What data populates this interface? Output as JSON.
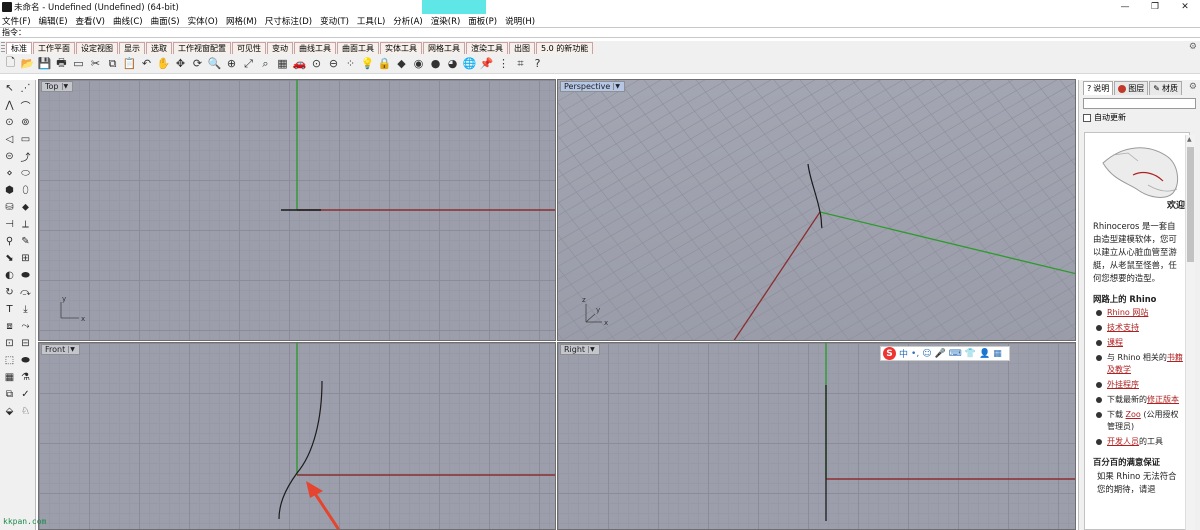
{
  "window": {
    "title": "未命名 - Undefined (Undefined) (64-bit)",
    "controls": {
      "minimize": "—",
      "maximize": "❐",
      "close": "✕"
    }
  },
  "menu": [
    "文件(F)",
    "编辑(E)",
    "查看(V)",
    "曲线(C)",
    "曲面(S)",
    "实体(O)",
    "网格(M)",
    "尺寸标注(D)",
    "变动(T)",
    "工具(L)",
    "分析(A)",
    "渲染(R)",
    "面板(P)",
    "说明(H)"
  ],
  "command": {
    "label": "指令：",
    "value": ""
  },
  "tabs": [
    "标准",
    "工作平面",
    "设定视图",
    "显示",
    "选取",
    "工作视窗配置",
    "可见性",
    "变动",
    "曲线工具",
    "曲面工具",
    "实体工具",
    "网格工具",
    "渲染工具",
    "出图",
    "5.0 的新功能"
  ],
  "active_tab": 0,
  "toolbar_icons": [
    {
      "icon": "new-file-icon",
      "glyph": "🗋"
    },
    {
      "icon": "open-folder-icon",
      "glyph": "📂"
    },
    {
      "icon": "save-icon",
      "glyph": "💾"
    },
    {
      "icon": "print-icon",
      "glyph": "🖶"
    },
    {
      "icon": "document-icon",
      "glyph": "▭"
    },
    {
      "icon": "cut-icon",
      "glyph": "✂"
    },
    {
      "icon": "copy-icon",
      "glyph": "⧉"
    },
    {
      "icon": "paste-icon",
      "glyph": "📋"
    },
    {
      "icon": "undo-icon",
      "glyph": "↶"
    },
    {
      "icon": "pan-hand-icon",
      "glyph": "✋"
    },
    {
      "icon": "move-icon",
      "glyph": "✥"
    },
    {
      "icon": "rotate-view-icon",
      "glyph": "⟳"
    },
    {
      "icon": "zoom-icon",
      "glyph": "🔍"
    },
    {
      "icon": "zoom-window-icon",
      "glyph": "⊕"
    },
    {
      "icon": "zoom-extents-icon",
      "glyph": "⤢"
    },
    {
      "icon": "zoom-selected-icon",
      "glyph": "⌕"
    },
    {
      "icon": "viewport-layout-icon",
      "glyph": "▦"
    },
    {
      "icon": "car-icon",
      "glyph": "🚗"
    },
    {
      "icon": "view-setup-icon",
      "glyph": "⊙"
    },
    {
      "icon": "cplane-icon",
      "glyph": "⊖"
    },
    {
      "icon": "select-points-icon",
      "glyph": "⁘"
    },
    {
      "icon": "light-icon",
      "glyph": "💡"
    },
    {
      "icon": "lock-icon",
      "glyph": "🔒"
    },
    {
      "icon": "shaded-icon",
      "glyph": "◆"
    },
    {
      "icon": "color-wheel-icon",
      "glyph": "◉"
    },
    {
      "icon": "sphere-icon",
      "glyph": "●"
    },
    {
      "icon": "render-sphere-icon",
      "glyph": "◕"
    },
    {
      "icon": "globe-icon",
      "glyph": "🌐"
    },
    {
      "icon": "pin-icon",
      "glyph": "📌"
    },
    {
      "icon": "grid-snap-icon",
      "glyph": "⋮"
    },
    {
      "icon": "history-icon",
      "glyph": "⌗"
    },
    {
      "icon": "help-icon",
      "glyph": "?"
    }
  ],
  "left_tools": [
    [
      "↖",
      "⋰"
    ],
    [
      "⋀",
      "⌒"
    ],
    [
      "⊙",
      "⊚"
    ],
    [
      "◁",
      "▭"
    ],
    [
      "⊝",
      "⤴"
    ],
    [
      "⋄",
      "⬭"
    ],
    [
      "⬢",
      "⬯"
    ],
    [
      "⛁",
      "⬥"
    ],
    [
      "⊣",
      "⟂"
    ],
    [
      "⚲",
      "✎"
    ],
    [
      "⬊",
      "⊞"
    ],
    [
      "◐",
      "⬬"
    ],
    [
      "↻",
      "⤼"
    ],
    [
      "T",
      "⤓"
    ],
    [
      "⧈",
      "⤳"
    ],
    [
      "⊡",
      "⊟"
    ],
    [
      "⬚",
      "⬬"
    ],
    [
      "▦",
      "⚗"
    ],
    [
      "⧉",
      "✓"
    ],
    [
      "⬙",
      "♘"
    ]
  ],
  "viewports": {
    "top": {
      "label": "Top",
      "axis_y": "y",
      "axis_x": "x"
    },
    "perspective": {
      "label": "Perspective",
      "axis_z": "z",
      "axis_y": "y",
      "axis_x": "x"
    },
    "front": {
      "label": "Front"
    },
    "right": {
      "label": "Right"
    }
  },
  "ime": {
    "logo": "S",
    "lang": "中",
    "icons": [
      "•,",
      "☺",
      "🎤",
      "⌨",
      "👕",
      "👤",
      "▦"
    ]
  },
  "panel": {
    "tabs": [
      "说明",
      "图层",
      "材质"
    ],
    "checkbox": "自动更新",
    "welcome": "欢迎",
    "intro": "Rhinoceros 是一套自由造型建模软体，您可以建立从心脏血管至游艇，从老鼠至怪兽，任何您想要的造型。",
    "section1": "网路上的 Rhino",
    "links": [
      {
        "text": "Rhino 网站",
        "type": "link"
      },
      {
        "text": "技术支持",
        "type": "link"
      },
      {
        "text": "课程",
        "type": "link"
      },
      {
        "pre": "与 Rhino 相关的",
        "text": "书籍及教学"
      },
      {
        "text": "外挂程序",
        "type": "link"
      },
      {
        "pre": "下载最新的",
        "text": "修正版本"
      },
      {
        "pre": "下载 ",
        "text": "Zoo",
        "post": " (公用授权管理员)"
      },
      {
        "text": "开发人员",
        "post": "的工具"
      }
    ],
    "section2": "百分百的满意保证",
    "footer": "如果 Rhino 无法符合您的期待，请退"
  },
  "watermark": "kkpan.com",
  "colors": {
    "viewport_bg": "#9c9fab",
    "x_axis": "#8a2f2f",
    "y_axis": "#2e9a2e",
    "accent_red": "#b02222"
  }
}
